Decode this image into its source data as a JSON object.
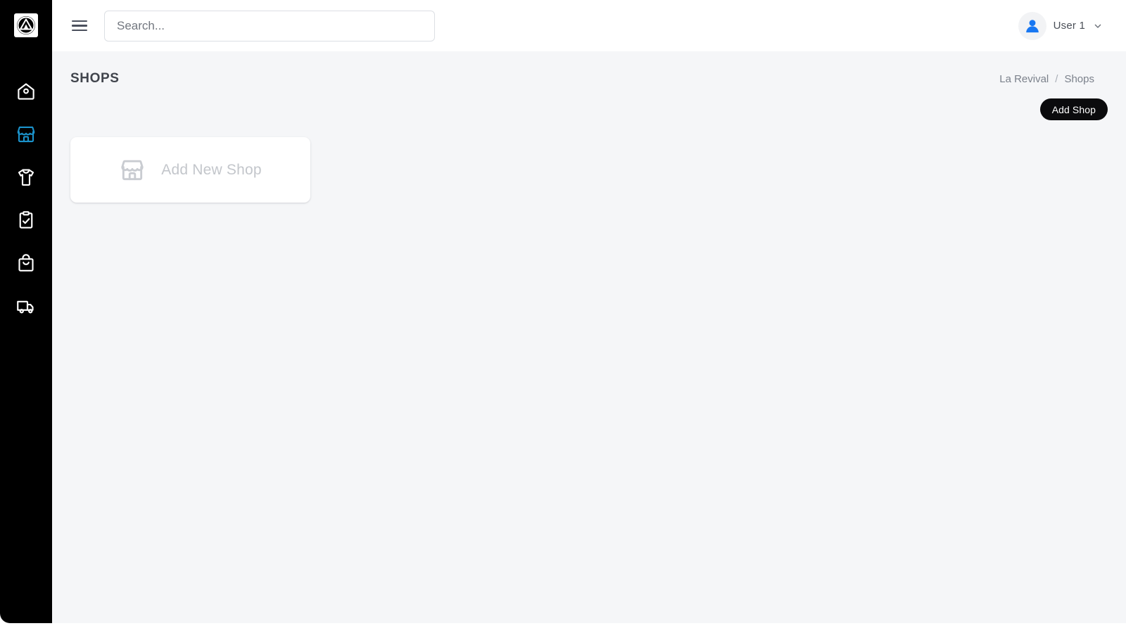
{
  "app": {
    "logo_icon": "triangle-in-circle-logo",
    "accent_color": "#1b93cc",
    "sidebar_bg": "#000000",
    "content_bg": "#f5f6f8",
    "button_bg": "#0b0b0d"
  },
  "sidebar": {
    "items": [
      {
        "name": "home",
        "icon": "home-icon",
        "active": false
      },
      {
        "name": "shops",
        "icon": "store-icon",
        "active": true
      },
      {
        "name": "products",
        "icon": "tshirt-icon",
        "active": false
      },
      {
        "name": "orders",
        "icon": "clipboard-check-icon",
        "active": false
      },
      {
        "name": "bag",
        "icon": "shopping-bag-icon",
        "active": false
      },
      {
        "name": "shipping",
        "icon": "truck-icon",
        "active": false
      }
    ]
  },
  "header": {
    "menu_toggle_icon": "hamburger-icon",
    "search": {
      "value": "",
      "placeholder": "Search..."
    },
    "user": {
      "avatar_icon": "user-avatar-icon",
      "name": "User 1",
      "dropdown_icon": "chevron-down-icon"
    }
  },
  "page": {
    "title": "SHOPS",
    "breadcrumb": {
      "root": "La Revival",
      "separator": "/",
      "current": "Shops"
    },
    "add_shop_button": "Add Shop",
    "cards": [
      {
        "icon": "store-icon",
        "label": "Add New Shop"
      }
    ]
  }
}
